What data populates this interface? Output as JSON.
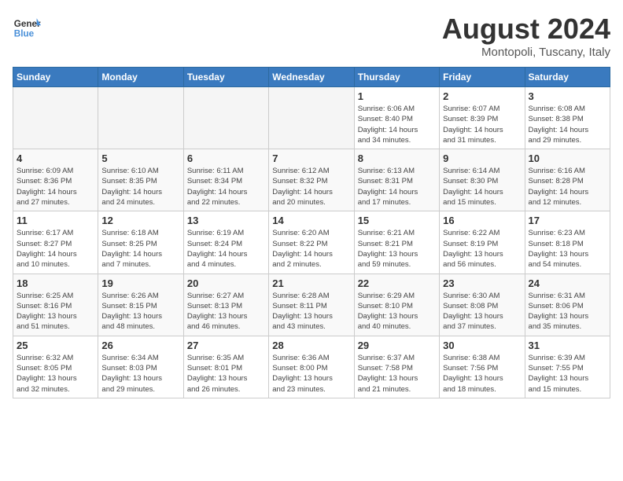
{
  "header": {
    "logo_line1": "General",
    "logo_line2": "Blue",
    "month_year": "August 2024",
    "location": "Montopoli, Tuscany, Italy"
  },
  "weekdays": [
    "Sunday",
    "Monday",
    "Tuesday",
    "Wednesday",
    "Thursday",
    "Friday",
    "Saturday"
  ],
  "weeks": [
    [
      {
        "day": "",
        "info": ""
      },
      {
        "day": "",
        "info": ""
      },
      {
        "day": "",
        "info": ""
      },
      {
        "day": "",
        "info": ""
      },
      {
        "day": "1",
        "info": "Sunrise: 6:06 AM\nSunset: 8:40 PM\nDaylight: 14 hours\nand 34 minutes."
      },
      {
        "day": "2",
        "info": "Sunrise: 6:07 AM\nSunset: 8:39 PM\nDaylight: 14 hours\nand 31 minutes."
      },
      {
        "day": "3",
        "info": "Sunrise: 6:08 AM\nSunset: 8:38 PM\nDaylight: 14 hours\nand 29 minutes."
      }
    ],
    [
      {
        "day": "4",
        "info": "Sunrise: 6:09 AM\nSunset: 8:36 PM\nDaylight: 14 hours\nand 27 minutes."
      },
      {
        "day": "5",
        "info": "Sunrise: 6:10 AM\nSunset: 8:35 PM\nDaylight: 14 hours\nand 24 minutes."
      },
      {
        "day": "6",
        "info": "Sunrise: 6:11 AM\nSunset: 8:34 PM\nDaylight: 14 hours\nand 22 minutes."
      },
      {
        "day": "7",
        "info": "Sunrise: 6:12 AM\nSunset: 8:32 PM\nDaylight: 14 hours\nand 20 minutes."
      },
      {
        "day": "8",
        "info": "Sunrise: 6:13 AM\nSunset: 8:31 PM\nDaylight: 14 hours\nand 17 minutes."
      },
      {
        "day": "9",
        "info": "Sunrise: 6:14 AM\nSunset: 8:30 PM\nDaylight: 14 hours\nand 15 minutes."
      },
      {
        "day": "10",
        "info": "Sunrise: 6:16 AM\nSunset: 8:28 PM\nDaylight: 14 hours\nand 12 minutes."
      }
    ],
    [
      {
        "day": "11",
        "info": "Sunrise: 6:17 AM\nSunset: 8:27 PM\nDaylight: 14 hours\nand 10 minutes."
      },
      {
        "day": "12",
        "info": "Sunrise: 6:18 AM\nSunset: 8:25 PM\nDaylight: 14 hours\nand 7 minutes."
      },
      {
        "day": "13",
        "info": "Sunrise: 6:19 AM\nSunset: 8:24 PM\nDaylight: 14 hours\nand 4 minutes."
      },
      {
        "day": "14",
        "info": "Sunrise: 6:20 AM\nSunset: 8:22 PM\nDaylight: 14 hours\nand 2 minutes."
      },
      {
        "day": "15",
        "info": "Sunrise: 6:21 AM\nSunset: 8:21 PM\nDaylight: 13 hours\nand 59 minutes."
      },
      {
        "day": "16",
        "info": "Sunrise: 6:22 AM\nSunset: 8:19 PM\nDaylight: 13 hours\nand 56 minutes."
      },
      {
        "day": "17",
        "info": "Sunrise: 6:23 AM\nSunset: 8:18 PM\nDaylight: 13 hours\nand 54 minutes."
      }
    ],
    [
      {
        "day": "18",
        "info": "Sunrise: 6:25 AM\nSunset: 8:16 PM\nDaylight: 13 hours\nand 51 minutes."
      },
      {
        "day": "19",
        "info": "Sunrise: 6:26 AM\nSunset: 8:15 PM\nDaylight: 13 hours\nand 48 minutes."
      },
      {
        "day": "20",
        "info": "Sunrise: 6:27 AM\nSunset: 8:13 PM\nDaylight: 13 hours\nand 46 minutes."
      },
      {
        "day": "21",
        "info": "Sunrise: 6:28 AM\nSunset: 8:11 PM\nDaylight: 13 hours\nand 43 minutes."
      },
      {
        "day": "22",
        "info": "Sunrise: 6:29 AM\nSunset: 8:10 PM\nDaylight: 13 hours\nand 40 minutes."
      },
      {
        "day": "23",
        "info": "Sunrise: 6:30 AM\nSunset: 8:08 PM\nDaylight: 13 hours\nand 37 minutes."
      },
      {
        "day": "24",
        "info": "Sunrise: 6:31 AM\nSunset: 8:06 PM\nDaylight: 13 hours\nand 35 minutes."
      }
    ],
    [
      {
        "day": "25",
        "info": "Sunrise: 6:32 AM\nSunset: 8:05 PM\nDaylight: 13 hours\nand 32 minutes."
      },
      {
        "day": "26",
        "info": "Sunrise: 6:34 AM\nSunset: 8:03 PM\nDaylight: 13 hours\nand 29 minutes."
      },
      {
        "day": "27",
        "info": "Sunrise: 6:35 AM\nSunset: 8:01 PM\nDaylight: 13 hours\nand 26 minutes."
      },
      {
        "day": "28",
        "info": "Sunrise: 6:36 AM\nSunset: 8:00 PM\nDaylight: 13 hours\nand 23 minutes."
      },
      {
        "day": "29",
        "info": "Sunrise: 6:37 AM\nSunset: 7:58 PM\nDaylight: 13 hours\nand 21 minutes."
      },
      {
        "day": "30",
        "info": "Sunrise: 6:38 AM\nSunset: 7:56 PM\nDaylight: 13 hours\nand 18 minutes."
      },
      {
        "day": "31",
        "info": "Sunrise: 6:39 AM\nSunset: 7:55 PM\nDaylight: 13 hours\nand 15 minutes."
      }
    ]
  ]
}
